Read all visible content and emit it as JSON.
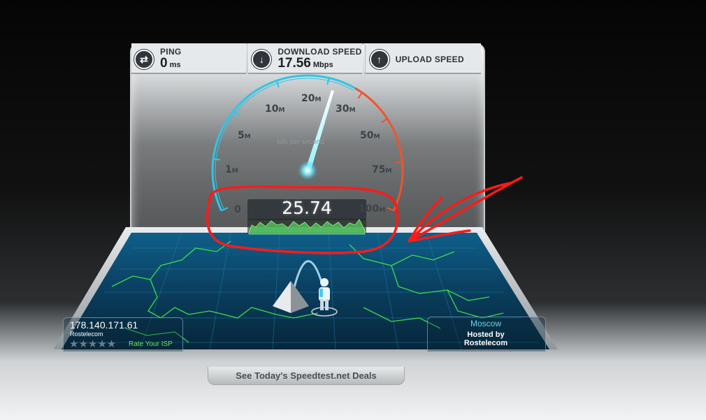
{
  "stats": {
    "ping_label": "PING",
    "ping_value": "0",
    "ping_unit": "ms",
    "download_label": "DOWNLOAD SPEED",
    "download_value": "17.56",
    "download_unit": "Mbps",
    "upload_label": "UPLOAD SPEED",
    "ping_icon": "arrows-exchange-icon",
    "download_icon": "arrow-down-icon",
    "upload_icon": "arrow-up-icon"
  },
  "gauge": {
    "current_speed": "25.74",
    "bps_label": "bits per second",
    "ticks": [
      {
        "value": "0",
        "suffix": ""
      },
      {
        "value": "1",
        "suffix": "M"
      },
      {
        "value": "5",
        "suffix": "M"
      },
      {
        "value": "10",
        "suffix": "M"
      },
      {
        "value": "20",
        "suffix": "M"
      },
      {
        "value": "30",
        "suffix": "M"
      },
      {
        "value": "50",
        "suffix": "M"
      },
      {
        "value": "75",
        "suffix": "M"
      },
      {
        "value": "100",
        "suffix": "M"
      }
    ],
    "accent": "#2fc6e6",
    "hot": "#f0542b"
  },
  "client": {
    "ip": "178.140.171.61",
    "isp": "Rostelecom",
    "stars": "★★★★★",
    "rate_link": "Rate Your ISP"
  },
  "server": {
    "city": "Moscow",
    "hosted_by": "Hosted by",
    "host": "Rostelecom"
  },
  "footer": {
    "deals_label": "See Today's Speedtest.net Deals"
  },
  "annotation_color": "#ff1a1a"
}
